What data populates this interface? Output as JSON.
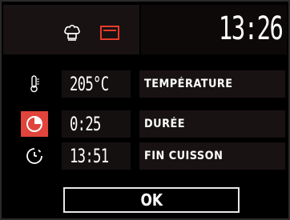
{
  "header": {
    "clock": "13:26",
    "icons": [
      "chef-hat-icon",
      "oven-mode-icon"
    ],
    "accent_color": "#e83b2a"
  },
  "params": [
    {
      "icon": "thermometer-icon",
      "value": "205°C",
      "label": "TEMPÉRATURE",
      "active": false
    },
    {
      "icon": "timer-icon",
      "value": "0:25",
      "label": "DURÉE",
      "active": true
    },
    {
      "icon": "end-clock-icon",
      "value": "13:51",
      "label": "FIN CUISSON",
      "active": false
    }
  ],
  "ok_button": {
    "label": "OK"
  }
}
